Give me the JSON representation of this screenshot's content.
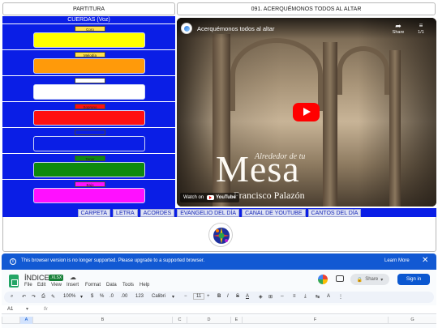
{
  "header": {
    "left_title": "PARTITURA",
    "right_title": "091. ACERQUÉMONOS TODOS AL ALTAR"
  },
  "left_panel": {
    "title": "CUERDAS (Voz)",
    "voices": [
      {
        "label": "Coro",
        "color": "#ffff00"
      },
      {
        "label": "Melodía",
        "color": "#ff9a0a"
      },
      {
        "label": "",
        "color": "#ffffff"
      },
      {
        "label": "Soprano",
        "color": "#ff1010"
      },
      {
        "label": "",
        "color": "#0a1ee6"
      },
      {
        "label": "Tenor",
        "color": "#0e8a0e"
      },
      {
        "label": "Bajo",
        "color": "#ff10ff"
      }
    ]
  },
  "video": {
    "title": "Acerquémonos todos al altar",
    "share_label": "Share",
    "playlist_count": "1/1",
    "overlay_small": "Alrededor de tu",
    "overlay_big": "Mesa",
    "overlay_author": "Francisco Palazón",
    "watch_on": "Watch on",
    "youtube_label": "YouTube"
  },
  "nav": {
    "links": [
      "CARPETA",
      "LETRA",
      "ACORDES",
      "EVANGELIO DEL DÍA",
      "CANAL DE YOUTUBE",
      "CANTOS DEL DÍA"
    ]
  },
  "warning": {
    "text": "This browser version is no longer supported. Please upgrade to a supported browser.",
    "learn_more": "Learn More",
    "close": "✕"
  },
  "sheets": {
    "doc_title": "ÍNDICE",
    "badge": ".XLSX",
    "menus": [
      "File",
      "Edit",
      "View",
      "Insert",
      "Format",
      "Data",
      "Tools",
      "Help"
    ],
    "share_label": "Share",
    "signin_label": "Sign in",
    "toolbar": {
      "zoom": "100%",
      "currency": "$",
      "percent": "%",
      "decimals_less": ".0",
      "decimals_more": ".00",
      "number_format": "123",
      "font": "Calibri",
      "font_size": "11",
      "bold": "B",
      "italic": "I"
    },
    "name_box": "A1",
    "fx": "fx",
    "columns": [
      "A",
      "B",
      "C",
      "D",
      "E",
      "F",
      "G"
    ]
  },
  "colors": {
    "panel_blue": "#0a1ee6",
    "warning_blue": "#1259d3",
    "signin_blue": "#0b57d0",
    "youtube_red": "#ff0000"
  }
}
